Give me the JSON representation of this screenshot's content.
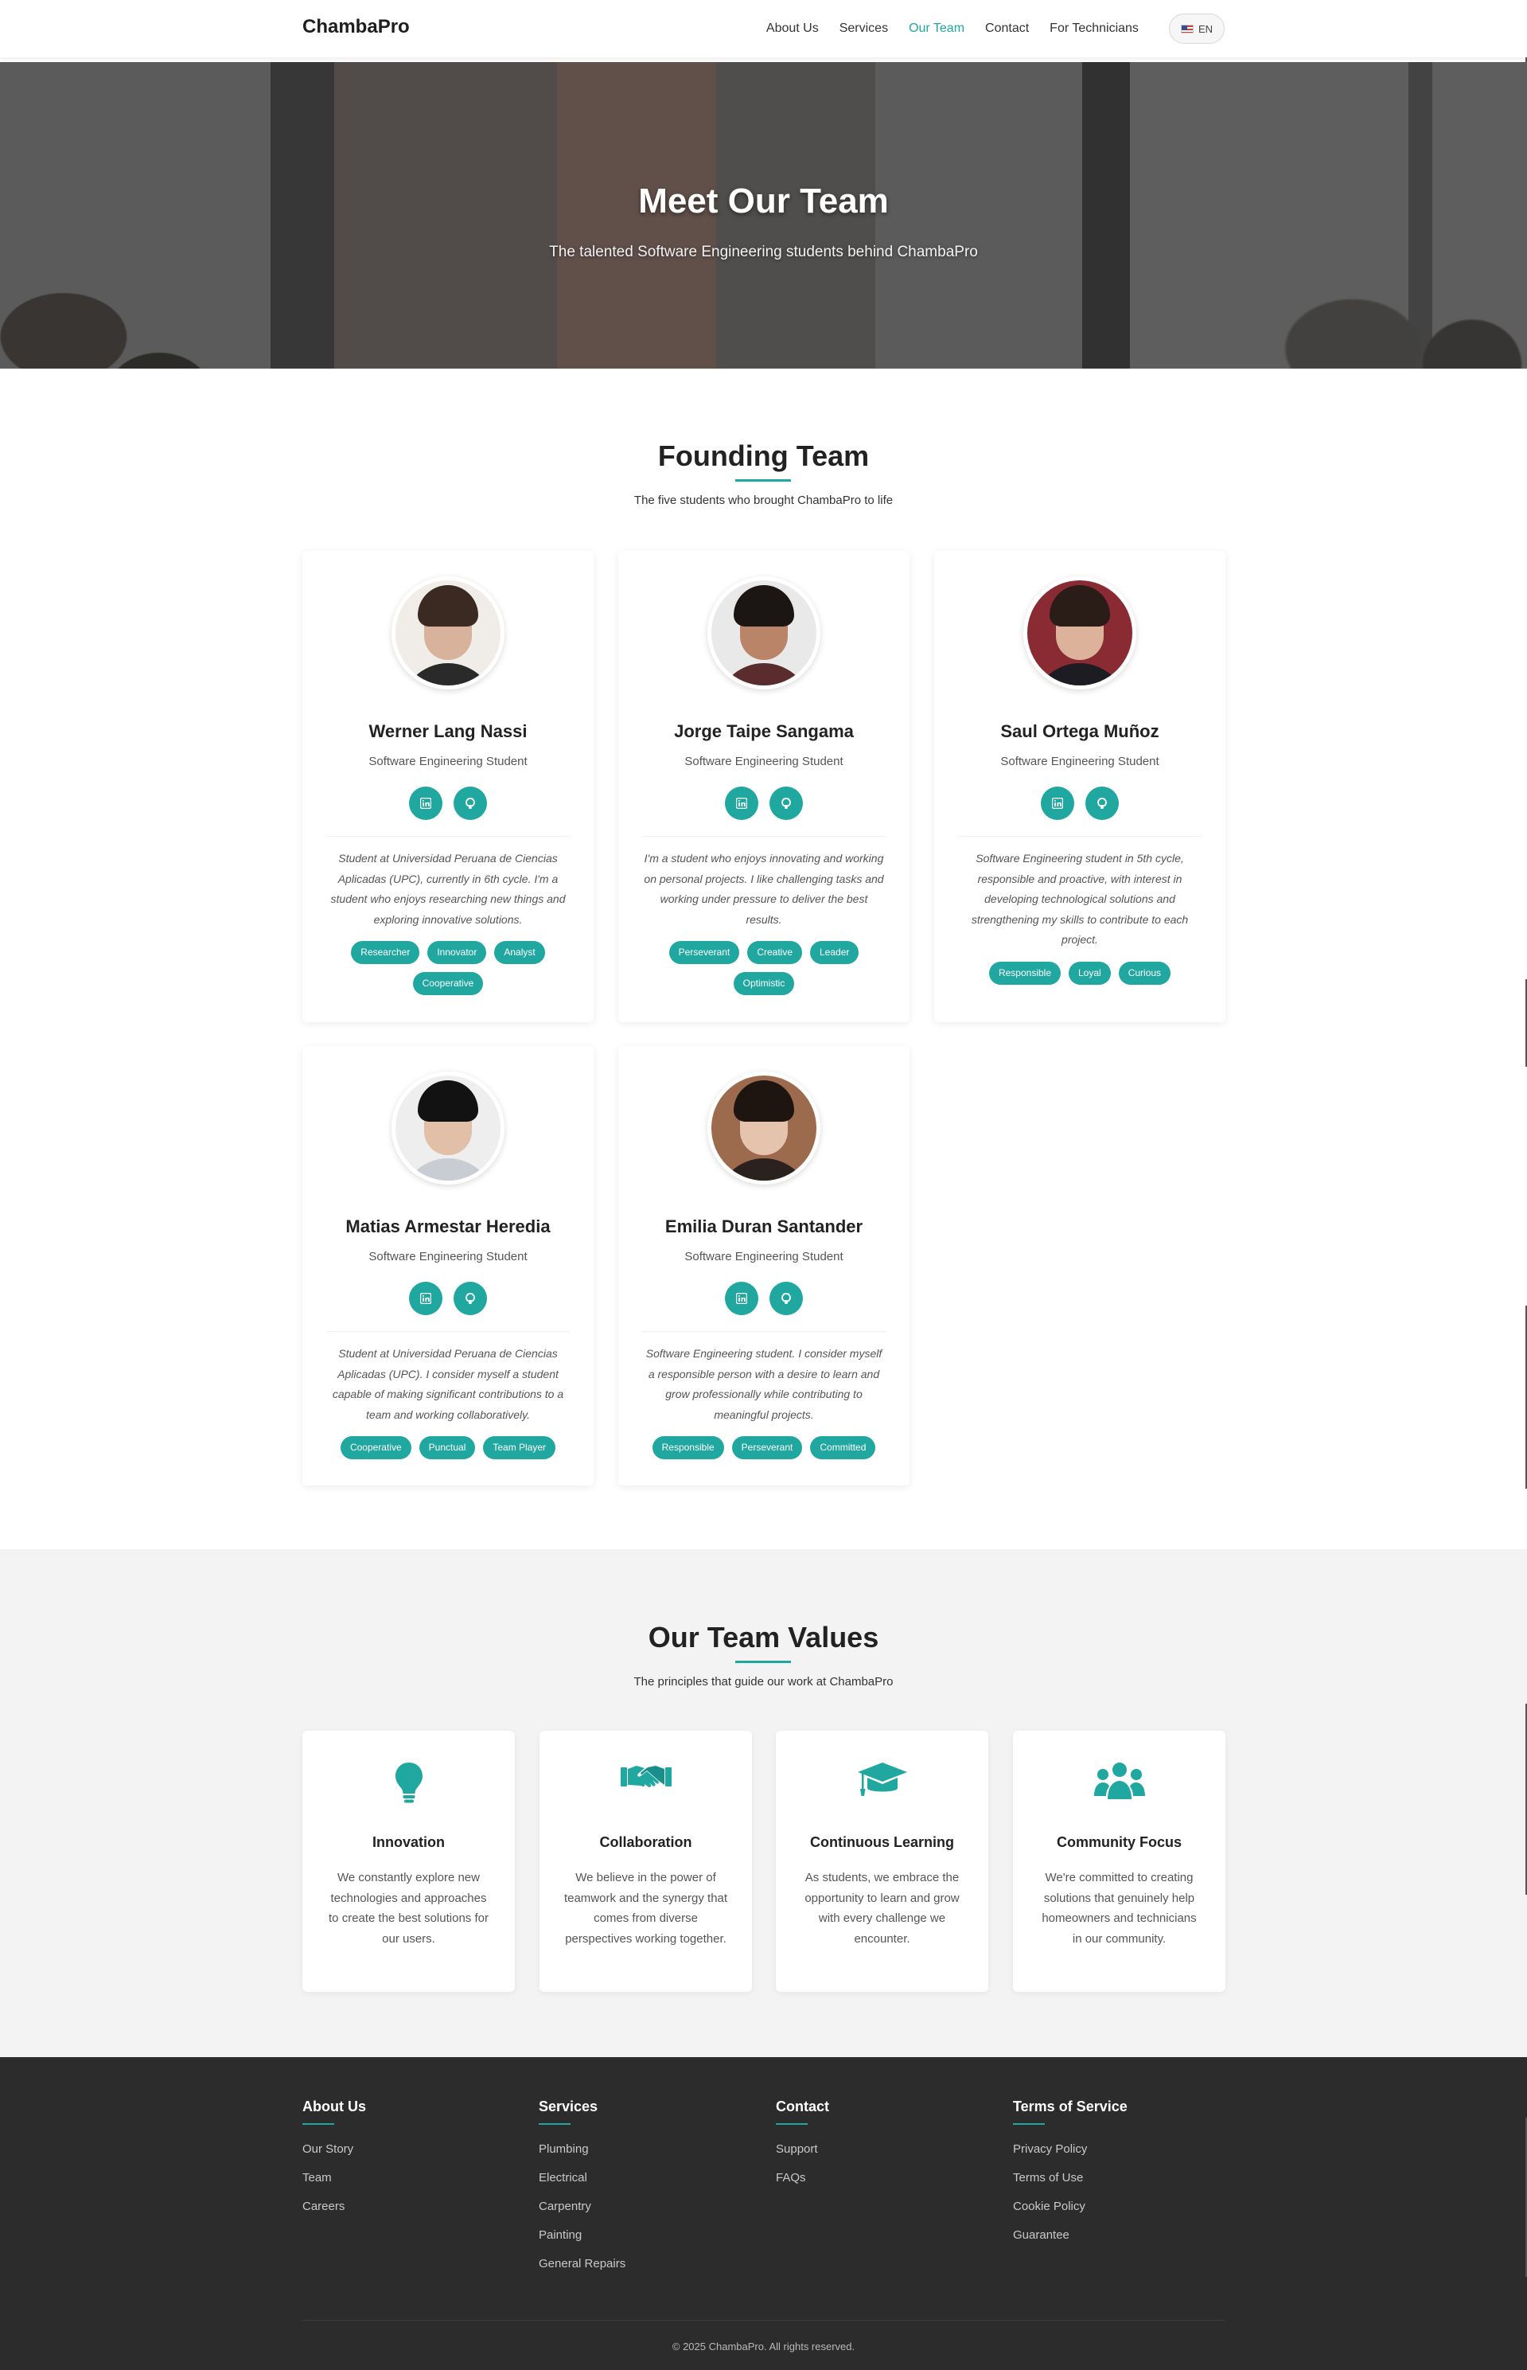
{
  "brand": "ChambaPro",
  "nav": {
    "items": [
      "About Us",
      "Services",
      "Our Team",
      "Contact",
      "For Technicians"
    ],
    "active": "Our Team",
    "language": "EN"
  },
  "hero": {
    "title": "Meet Our Team",
    "subtitle": "The talented Software Engineering students behind ChambaPro"
  },
  "founding": {
    "title": "Founding Team",
    "subtitle": "The five students who brought ChambaPro to life",
    "members": [
      {
        "name": "Werner Lang Nassi",
        "role": "Software Engineering Student",
        "bio": "Student at Universidad Peruana de Ciencias Aplicadas (UPC), currently in 6th cycle. I'm a student who enjoys researching new things and exploring innovative solutions.",
        "tags": [
          "Researcher",
          "Innovator",
          "Analyst",
          "Cooperative"
        ]
      },
      {
        "name": "Jorge Taipe Sangama",
        "role": "Software Engineering Student",
        "bio": "I'm a student who enjoys innovating and working on personal projects. I like challenging tasks and working under pressure to deliver the best results.",
        "tags": [
          "Perseverant",
          "Creative",
          "Leader",
          "Optimistic"
        ]
      },
      {
        "name": "Saul Ortega Muñoz",
        "role": "Software Engineering Student",
        "bio": "Software Engineering student in 5th cycle, responsible and proactive, with interest in developing technological solutions and strengthening my skills to contribute to each project.",
        "tags": [
          "Responsible",
          "Loyal",
          "Curious"
        ]
      },
      {
        "name": "Matias Armestar Heredia",
        "role": "Software Engineering Student",
        "bio": "Student at Universidad Peruana de Ciencias Aplicadas (UPC). I consider myself a student capable of making significant contributions to a team and working collaboratively.",
        "tags": [
          "Cooperative",
          "Punctual",
          "Team Player"
        ]
      },
      {
        "name": "Emilia Duran Santander",
        "role": "Software Engineering Student",
        "bio": "Software Engineering student. I consider myself a responsible person with a desire to learn and grow professionally while contributing to meaningful projects.",
        "tags": [
          "Responsible",
          "Perseverant",
          "Committed"
        ]
      }
    ]
  },
  "values": {
    "title": "Our Team Values",
    "subtitle": "The principles that guide our work at ChambaPro",
    "items": [
      {
        "icon": "lightbulb-icon",
        "title": "Innovation",
        "text": "We constantly explore new technologies and approaches to create the best solutions for our users."
      },
      {
        "icon": "handshake-icon",
        "title": "Collaboration",
        "text": "We believe in the power of teamwork and the synergy that comes from diverse perspectives working together."
      },
      {
        "icon": "graduation-cap-icon",
        "title": "Continuous Learning",
        "text": "As students, we embrace the opportunity to learn and grow with every challenge we encounter."
      },
      {
        "icon": "users-icon",
        "title": "Community Focus",
        "text": "We're committed to creating solutions that genuinely help homeowners and technicians in our community."
      }
    ]
  },
  "footer": {
    "columns": [
      {
        "title": "About Us",
        "links": [
          "Our Story",
          "Team",
          "Careers"
        ]
      },
      {
        "title": "Services",
        "links": [
          "Plumbing",
          "Electrical",
          "Carpentry",
          "Painting",
          "General Repairs"
        ]
      },
      {
        "title": "Contact",
        "links": [
          "Support",
          "FAQs"
        ]
      },
      {
        "title": "Terms of Service",
        "links": [
          "Privacy Policy",
          "Terms of Use",
          "Cookie Policy",
          "Guarantee"
        ]
      }
    ],
    "copyright": "© 2025 ChambaPro. All rights reserved."
  },
  "colors": {
    "accent": "#20a7a0",
    "footer_bg": "#2c2c2c",
    "values_bg": "#f3f3f3"
  }
}
